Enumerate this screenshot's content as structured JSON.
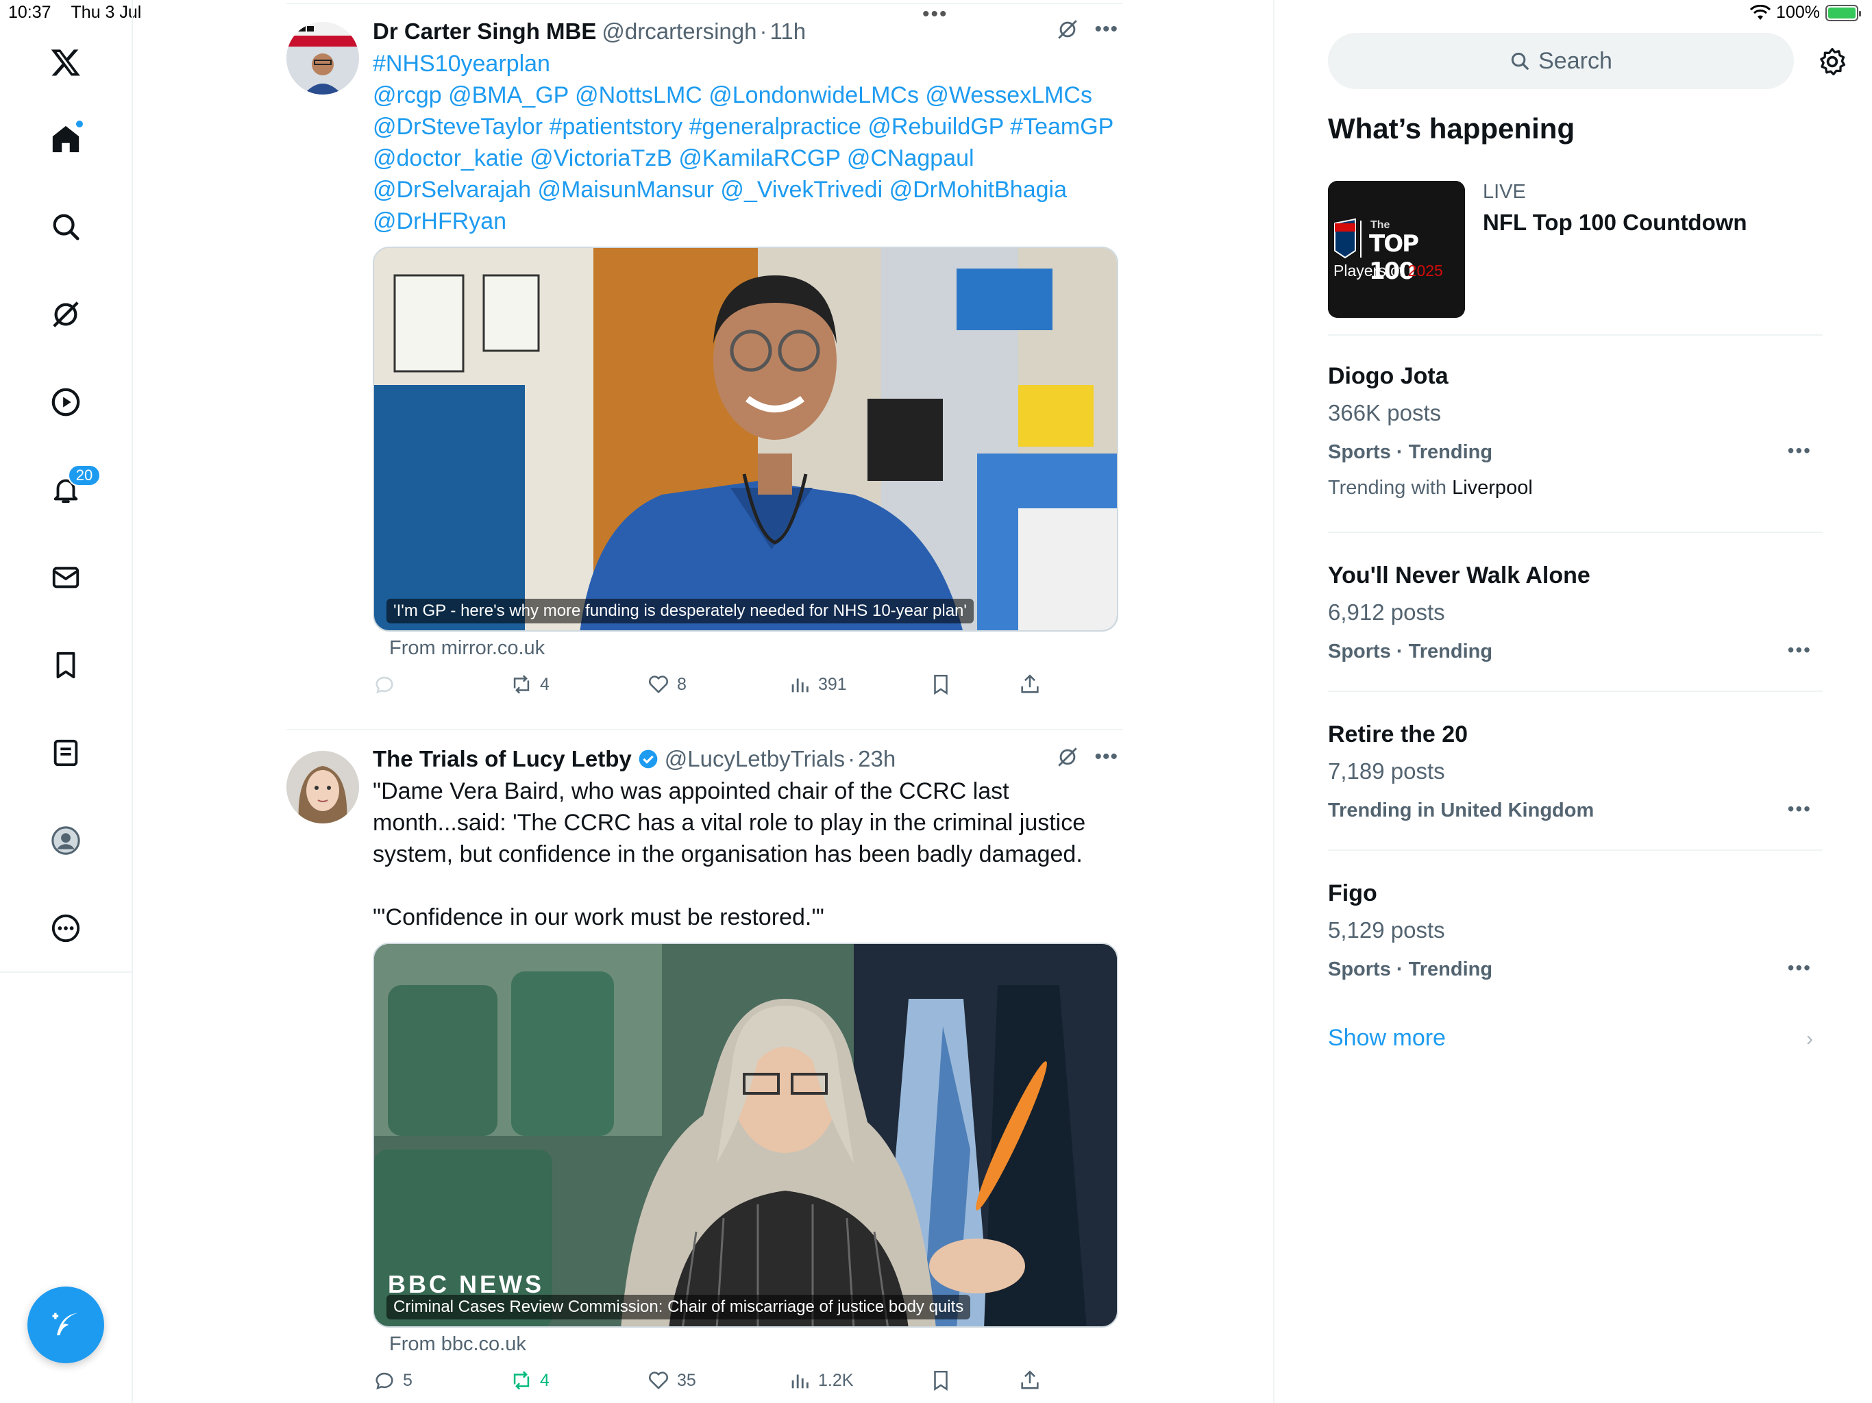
{
  "status_bar": {
    "time": "10:37",
    "date": "Thu 3 Jul",
    "battery": "100%",
    "battery_level": 1.0
  },
  "nav": {
    "notifications_count": "20",
    "items": [
      "x-logo-icon",
      "home-icon",
      "search-icon",
      "grok-icon",
      "video-icon",
      "bell-icon",
      "mail-icon",
      "bookmark-icon",
      "lists-icon",
      "profile-icon",
      "more-icon",
      "compose-icon"
    ]
  },
  "feed": {
    "tweets": [
      {
        "name": "Dr Carter Singh MBE",
        "handle": "@drcartersingh",
        "separator": "·",
        "time": "11h",
        "hashtag_line": "#NHS10yearplan",
        "text": "@rcgp @BMA_GP @NottsLMC @LondonwideLMCs @WessexLMCs @DrSteveTaylor #patientstory #generalpractice @RebuildGP #TeamGP @doctor_katie @VictoriaTzB @KamilaRCGP @CNagpaul @DrSelvarajah @MaisunMansur @_VivekTrivedi @DrMohitBhagia @DrHFRyan",
        "media_caption": "'I'm GP - here's why more funding is desperately needed for NHS 10-year plan'",
        "from": "From mirror.co.uk",
        "replies": "",
        "reposts": "4",
        "likes": "8",
        "views": "391"
      },
      {
        "name": "The Trials of Lucy Letby",
        "handle": "@LucyLetbyTrials",
        "separator": "·",
        "time": "23h",
        "text": "\"Dame Vera Baird, who was appointed chair of the CCRC last month...said: 'The CCRC has a vital role to play in the criminal justice system, but confidence in the organisation has been badly damaged.\n\n\"'Confidence in our work must be restored.'\"",
        "media_caption": "Criminal Cases Review Commission: Chair of miscarriage of justice body quits",
        "media_logo": "BBC NEWS",
        "from": "From bbc.co.uk",
        "replies": "5",
        "reposts": "4",
        "likes": "35",
        "views": "1.2K"
      }
    ]
  },
  "sidebar": {
    "search_placeholder": "Search",
    "title": "What’s happening",
    "live": {
      "label": "LIVE",
      "title": "NFL Top 100 Countdown",
      "thumb_the": "The",
      "thumb_top": "TOP 100",
      "thumb_players": "Players of",
      "thumb_year": "2025"
    },
    "trends": [
      {
        "name": "Diogo Jota",
        "posts": "366K posts",
        "category": "Sports · Trending",
        "with_label": "Trending with",
        "with_value": "Liverpool"
      },
      {
        "name": "You'll Never Walk Alone",
        "posts": "6,912 posts",
        "category": "Sports · Trending"
      },
      {
        "name": "Retire the 20",
        "posts": "7,189 posts",
        "category": "Trending in United Kingdom"
      },
      {
        "name": "Figo",
        "posts": "5,129 posts",
        "category": "Sports · Trending"
      }
    ],
    "show_more": "Show more"
  },
  "colors": {
    "accent": "#1d9bf0",
    "text": "#0f1419",
    "muted": "#536471",
    "border": "#eff3f4",
    "repost_active": "#00ba7c"
  }
}
